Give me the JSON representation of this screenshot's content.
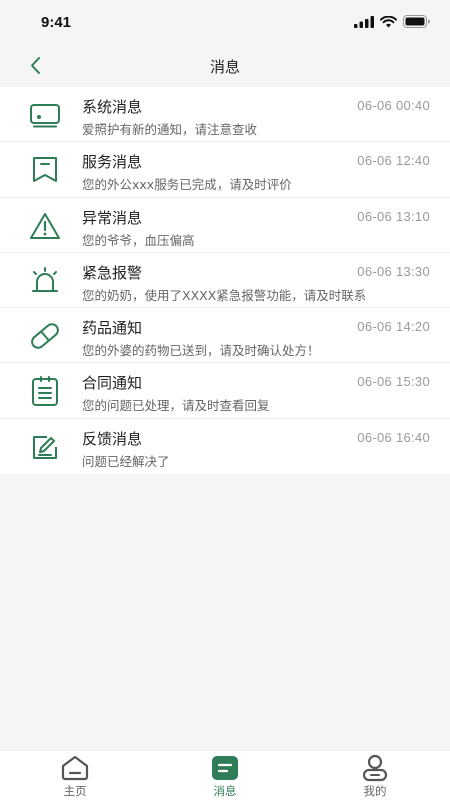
{
  "status_bar": {
    "time": "9:41"
  },
  "header": {
    "title": "消息"
  },
  "accent_color": "#2e7d57",
  "messages": [
    {
      "icon": "monitor-icon",
      "title": "系统消息",
      "subtitle": "爱照护有新的通知，请注意查收",
      "time": "06-06 00:40"
    },
    {
      "icon": "service-flag-icon",
      "title": "服务消息",
      "subtitle": "您的外公xxx服务已完成，请及时评价",
      "time": "06-06 12:40"
    },
    {
      "icon": "warning-icon",
      "title": "异常消息",
      "subtitle": "您的爷爷，血压偏高",
      "time": "06-06 13:10"
    },
    {
      "icon": "alarm-siren-icon",
      "title": "紧急报警",
      "subtitle": "您的奶奶，使用了XXXX紧急报警功能，请及时联系",
      "time": "06-06 13:30"
    },
    {
      "icon": "pill-icon",
      "title": "药品通知",
      "subtitle": "您的外婆的药物已送到，请及时确认处方！",
      "time": "06-06 14:20"
    },
    {
      "icon": "clipboard-icon",
      "title": "合同通知",
      "subtitle": "您的问题已处理，请及时查看回复",
      "time": "06-06 15:30"
    },
    {
      "icon": "feedback-edit-icon",
      "title": "反馈消息",
      "subtitle": "问题已经解决了",
      "time": "06-06 16:40"
    }
  ],
  "tabs": [
    {
      "icon": "home-icon",
      "label": "主页",
      "active": false
    },
    {
      "icon": "message-icon",
      "label": "消息",
      "active": true
    },
    {
      "icon": "user-icon",
      "label": "我的",
      "active": false
    }
  ]
}
